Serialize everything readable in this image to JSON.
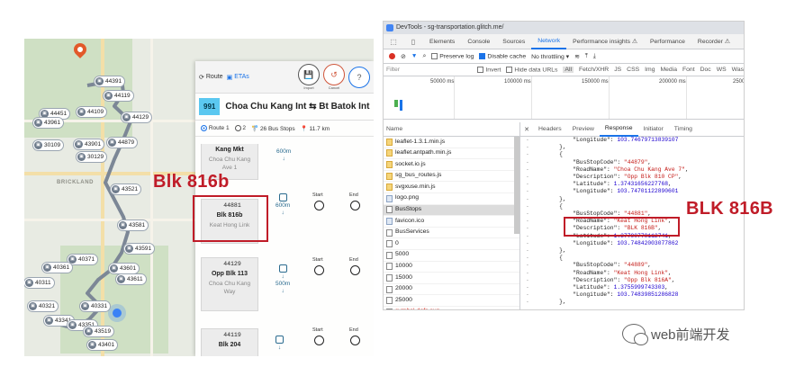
{
  "map": {
    "area_label": "BRICKLAND",
    "stops": [
      {
        "code": "44391"
      },
      {
        "code": "44119"
      },
      {
        "code": "44451"
      },
      {
        "code": "44109"
      },
      {
        "code": "44129"
      },
      {
        "code": "43961"
      },
      {
        "code": "30109"
      },
      {
        "code": "44879"
      },
      {
        "code": "43901"
      },
      {
        "code": "30129"
      },
      {
        "code": "43521"
      },
      {
        "code": "43581"
      },
      {
        "code": "43591"
      },
      {
        "code": "40371"
      },
      {
        "code": "40361"
      },
      {
        "code": "43601"
      },
      {
        "code": "43611"
      },
      {
        "code": "40311"
      },
      {
        "code": "40321"
      },
      {
        "code": "40331"
      },
      {
        "code": "43341"
      },
      {
        "code": "43351"
      },
      {
        "code": "43519"
      },
      {
        "code": "43401"
      }
    ],
    "panel": {
      "tab_route": "Route",
      "tab_etas": "ETAs",
      "btn_import": "Import",
      "btn_cancel": "Cancel",
      "btn_help": "?",
      "service": "991",
      "route_title": "Choa Chu Kang Int ⇆ Bt Batok Int",
      "route1": "Route 1",
      "route2": "2",
      "bus_stops": "26 Bus Stops",
      "distance": "11.7 km",
      "cards": [
        {
          "code": "",
          "name": "Kang Mkt",
          "road": "Choa Chu Kang Ave 1"
        },
        {
          "code": "44881",
          "name": "Blk 816b",
          "road": "Keat Hong Link"
        },
        {
          "code": "44129",
          "name": "Opp Blk 113",
          "road": "Choa Chu Kang Way"
        },
        {
          "code": "44119",
          "name": "Blk 204",
          "road": ""
        }
      ],
      "dists": [
        "600m",
        "600m",
        "500m"
      ],
      "start_label": "Start",
      "end_label": "End"
    },
    "annotation": "Blk 816b"
  },
  "devtools": {
    "window_title": "DevTools - sg-transportation.glitch.me/",
    "tabs": [
      "Elements",
      "Console",
      "Sources",
      "Network",
      "Performance insights ⚠",
      "Performance",
      "Recorder ⚠"
    ],
    "active_tab": "Network",
    "toolbar": {
      "preserve_log": "Preserve log",
      "disable_cache": "Disable cache",
      "throttle": "No throttling"
    },
    "filter": {
      "label": "Filter",
      "invert": "Invert",
      "hide_data": "Hide data URLs",
      "all": "All",
      "types": [
        "Fetch/XHR",
        "JS",
        "CSS",
        "Img",
        "Media",
        "Font",
        "Doc",
        "WS",
        "Was"
      ]
    },
    "timeline_ticks": [
      "50000 ms",
      "100000 ms",
      "150000 ms",
      "200000 ms",
      "2500"
    ],
    "name_header": "Name",
    "files": [
      {
        "name": "leaflet-1.3.1.min.js",
        "type": "js"
      },
      {
        "name": "leaflet.antpath.min.js",
        "type": "js"
      },
      {
        "name": "socket.io.js",
        "type": "js"
      },
      {
        "name": "sg_bus_routes.js",
        "type": "js"
      },
      {
        "name": "svgxuse.min.js",
        "type": "js"
      },
      {
        "name": "logo.png",
        "type": "img"
      },
      {
        "name": "BusStops",
        "type": "data"
      },
      {
        "name": "favicon.ico",
        "type": "img"
      },
      {
        "name": "BusServices",
        "type": "data"
      },
      {
        "name": "0",
        "type": "data"
      },
      {
        "name": "5000",
        "type": "data"
      },
      {
        "name": "10000",
        "type": "data"
      },
      {
        "name": "15000",
        "type": "data"
      },
      {
        "name": "20000",
        "type": "data"
      },
      {
        "name": "25000",
        "type": "data"
      },
      {
        "name": "symbol-defs.svg",
        "type": "err"
      }
    ],
    "resp_tabs": [
      "Headers",
      "Preview",
      "Response",
      "Initiator",
      "Timing"
    ],
    "active_resp": "Response",
    "lines": [
      "        \"Longitude\": 103.74679713839107",
      "    },",
      "    {",
      "        \"BusStopCode\": \"44879\",",
      "        \"RoadName\": \"Choa Chu Kang Ave 7\",",
      "        \"Description\": \"Opp Blk 810 CP\",",
      "        \"Latitude\": 1.37431656227768,",
      "        \"Longitude\": 103.74701122890601",
      "    },",
      "    {",
      "        \"BusStopCode\": \"44881\",",
      "        \"RoadName\": \"Keat Hong Link\",",
      "        \"Description\": \"BLK 816B\",",
      "        \"Latitude\": 1.37790779112741,",
      "        \"Longitude\": 103.74842003077862",
      "    },",
      "    {",
      "        \"BusStopCode\": \"44889\",",
      "        \"RoadName\": \"Keat Hong Link\",",
      "        \"Description\": \"Opp Blk 816A\",",
      "        \"Latitude\": 1.3755999743303,",
      "        \"Longitude\": 103.74839851286828",
      "    },"
    ],
    "annotation": "BLK 816B"
  },
  "watermark": "web前端开发"
}
